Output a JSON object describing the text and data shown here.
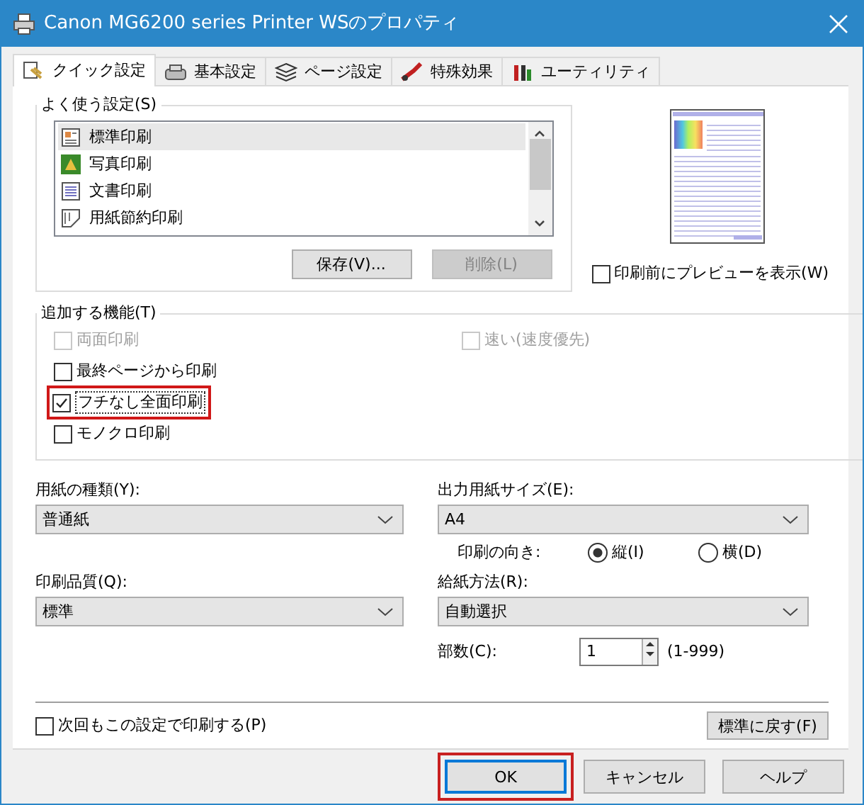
{
  "window": {
    "title": "Canon MG6200 series Printer WSのプロパティ"
  },
  "tabs": [
    {
      "label": "クイック設定",
      "selected": true,
      "kind": "quick"
    },
    {
      "label": "基本設定",
      "selected": false,
      "kind": "basic"
    },
    {
      "label": "ページ設定",
      "selected": false,
      "kind": "page"
    },
    {
      "label": "特殊効果",
      "selected": false,
      "kind": "effects"
    },
    {
      "label": "ユーティリティ",
      "selected": false,
      "kind": "utility"
    }
  ],
  "favorites": {
    "label": "よく使う設定(S)",
    "items": [
      {
        "label": "標準印刷",
        "selected": true,
        "kind": "standard"
      },
      {
        "label": "写真印刷",
        "selected": false,
        "kind": "photo"
      },
      {
        "label": "文書印刷",
        "selected": false,
        "kind": "document"
      },
      {
        "label": "用紙節約印刷",
        "selected": false,
        "kind": "saving"
      }
    ],
    "buttons": [
      {
        "label": "保存(V)...",
        "disabled": false
      },
      {
        "label": "削除(L)",
        "disabled": true
      }
    ]
  },
  "preview_checkbox": {
    "label": "印刷前にプレビューを表示(W)",
    "checked": false
  },
  "features": {
    "label": "追加する機能(T)",
    "left": [
      {
        "label": "両面印刷",
        "checked": false,
        "disabled": true,
        "highlighted": false
      },
      {
        "label": "最終ページから印刷",
        "checked": false,
        "disabled": false,
        "highlighted": false
      },
      {
        "label": "フチなし全面印刷",
        "checked": true,
        "disabled": false,
        "highlighted": true
      },
      {
        "label": "モノクロ印刷",
        "checked": false,
        "disabled": false,
        "highlighted": false
      }
    ],
    "right": [
      {
        "label": "速い(速度優先)",
        "checked": false,
        "disabled": true,
        "highlighted": false
      }
    ]
  },
  "paper_type": {
    "label": "用紙の種類(Y):",
    "value": "普通紙"
  },
  "output_size": {
    "label": "出力用紙サイズ(E):",
    "value": "A4"
  },
  "orientation": {
    "label": "印刷の向き:",
    "options": [
      {
        "label": "縦(I)",
        "selected": true
      },
      {
        "label": "横(D)",
        "selected": false
      }
    ]
  },
  "quality": {
    "label": "印刷品質(Q):",
    "value": "標準"
  },
  "paper_source": {
    "label": "給紙方法(R):",
    "value": "自動選択"
  },
  "copies": {
    "label": "部数(C):",
    "value": "1",
    "range": "(1-999)"
  },
  "remember_checkbox": {
    "label": "次回もこの設定で印刷する(P)",
    "checked": false
  },
  "reset_button": {
    "label": "標準に戻す(F)"
  },
  "buttons": [
    {
      "label": "OK",
      "default": true,
      "highlighted": true
    },
    {
      "label": "キャンセル",
      "default": false,
      "highlighted": false
    },
    {
      "label": "ヘルプ",
      "default": false,
      "highlighted": false
    }
  ]
}
